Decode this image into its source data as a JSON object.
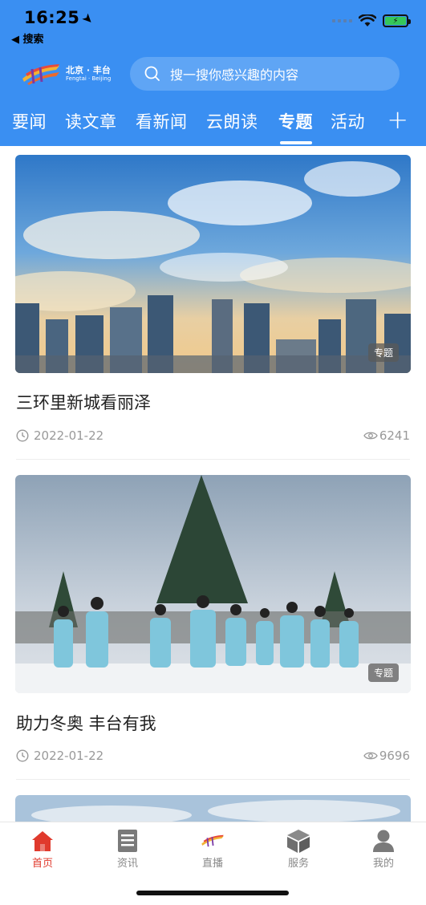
{
  "status_bar": {
    "time": "16:25",
    "back_label": "◀ 搜索"
  },
  "brand": {
    "name_cn": "北京 · 丰台",
    "name_en": "Fengtai · Beijing"
  },
  "search": {
    "placeholder": "搜一搜你感兴趣的内容"
  },
  "tabs": [
    {
      "label": "要闻"
    },
    {
      "label": "读文章"
    },
    {
      "label": "看新闻"
    },
    {
      "label": "云朗读"
    },
    {
      "label": "专题",
      "active": true
    },
    {
      "label": "活动"
    }
  ],
  "add_tab_label": "+",
  "feed": [
    {
      "title": "三环里新城看丽泽",
      "date": "2022-01-22",
      "views": "6241",
      "badge": "专题"
    },
    {
      "title": "助力冬奥 丰台有我",
      "date": "2022-01-22",
      "views": "9696",
      "badge": "专题"
    }
  ],
  "tabbar": [
    {
      "label": "首页",
      "icon": "home-icon",
      "active": true
    },
    {
      "label": "资讯",
      "icon": "news-icon"
    },
    {
      "label": "直播",
      "icon": "live-icon"
    },
    {
      "label": "服务",
      "icon": "service-icon"
    },
    {
      "label": "我的",
      "icon": "profile-icon"
    }
  ],
  "colors": {
    "header_blue": "#3a8ff2",
    "active_red": "#e03a2d"
  }
}
